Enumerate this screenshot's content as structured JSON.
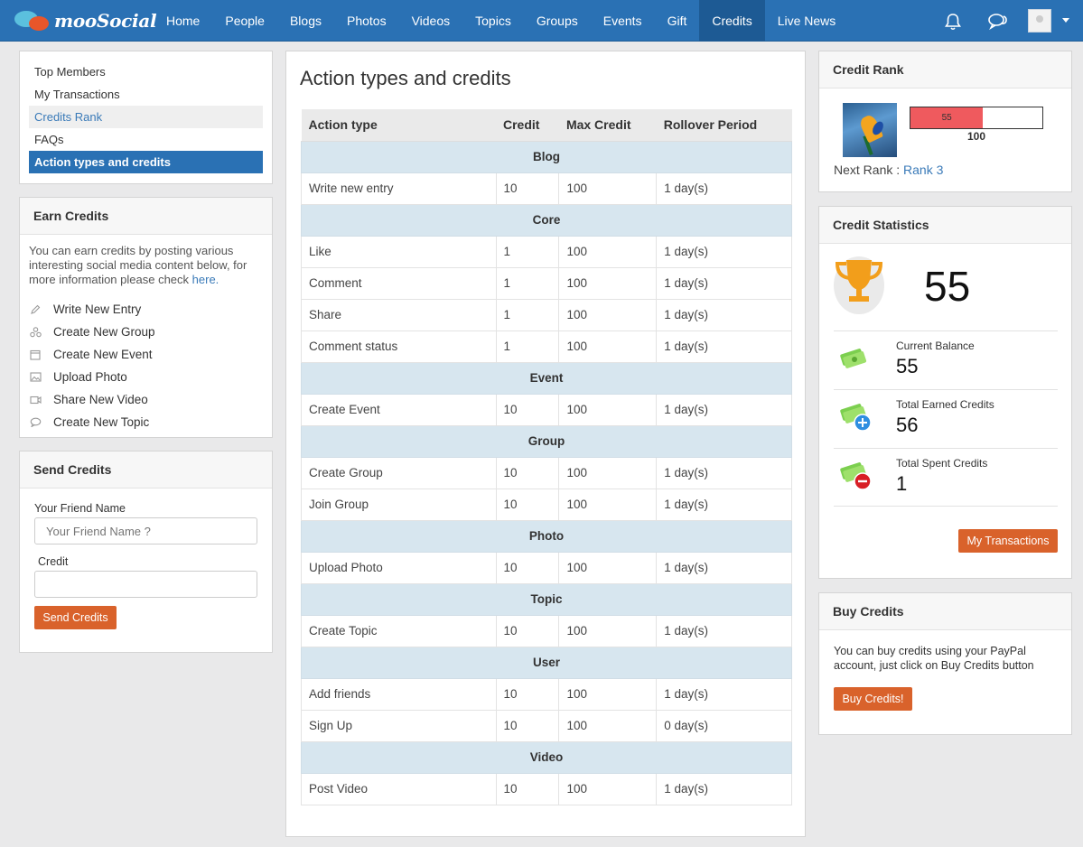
{
  "brand": {
    "name": "mooSocial"
  },
  "nav": {
    "items": [
      "Home",
      "People",
      "Blogs",
      "Photos",
      "Videos",
      "Topics",
      "Groups",
      "Events",
      "Gift",
      "Credits",
      "Live News"
    ],
    "active": "Credits"
  },
  "icons": {
    "notifications": "bell-icon",
    "messages": "chat-icon",
    "account": "avatar",
    "account_menu": "caret-down-icon"
  },
  "left_menu": {
    "items": [
      "Top Members",
      "My Transactions",
      "Credits Rank",
      "FAQs",
      "Action types and credits"
    ],
    "highlighted": "Credits Rank",
    "active": "Action types and credits"
  },
  "earn_credits": {
    "title": "Earn Credits",
    "description": "You can earn credits by posting various interesting social media content below, for more information please check",
    "link": "here.",
    "items": [
      {
        "label": "Write New Entry",
        "icon": "pencil-icon"
      },
      {
        "label": "Create New Group",
        "icon": "group-icon"
      },
      {
        "label": "Create New Event",
        "icon": "calendar-icon"
      },
      {
        "label": "Upload Photo",
        "icon": "image-icon"
      },
      {
        "label": "Share New Video",
        "icon": "video-icon"
      },
      {
        "label": "Create New Topic",
        "icon": "topic-icon"
      }
    ]
  },
  "send_credits": {
    "title": "Send Credits",
    "friend_label": "Your Friend Name",
    "friend_placeholder": "Your Friend Name ?",
    "credit_label": "Credit",
    "credit_value": "",
    "button": "Send Credits"
  },
  "main": {
    "title": "Action types and credits",
    "columns": [
      "Action type",
      "Credit",
      "Max Credit",
      "Rollover Period"
    ],
    "groups": [
      {
        "name": "Blog",
        "rows": [
          [
            "Write new entry",
            "10",
            "100",
            "1 day(s)"
          ]
        ]
      },
      {
        "name": "Core",
        "rows": [
          [
            "Like",
            "1",
            "100",
            "1 day(s)"
          ],
          [
            "Comment",
            "1",
            "100",
            "1 day(s)"
          ],
          [
            "Share",
            "1",
            "100",
            "1 day(s)"
          ],
          [
            "Comment status",
            "1",
            "100",
            "1 day(s)"
          ]
        ]
      },
      {
        "name": "Event",
        "rows": [
          [
            "Create Event",
            "10",
            "100",
            "1 day(s)"
          ]
        ]
      },
      {
        "name": "Group",
        "rows": [
          [
            "Create Group",
            "10",
            "100",
            "1 day(s)"
          ],
          [
            "Join Group",
            "10",
            "100",
            "1 day(s)"
          ]
        ]
      },
      {
        "name": "Photo",
        "rows": [
          [
            "Upload Photo",
            "10",
            "100",
            "1 day(s)"
          ]
        ]
      },
      {
        "name": "Topic",
        "rows": [
          [
            "Create Topic",
            "10",
            "100",
            "1 day(s)"
          ]
        ]
      },
      {
        "name": "User",
        "rows": [
          [
            "Add friends",
            "10",
            "100",
            "1 day(s)"
          ],
          [
            "Sign Up",
            "10",
            "100",
            "0 day(s)"
          ]
        ]
      },
      {
        "name": "Video",
        "rows": [
          [
            "Post Video",
            "10",
            "100",
            "1 day(s)"
          ]
        ]
      }
    ]
  },
  "credit_rank": {
    "title": "Credit Rank",
    "progress_value": "55",
    "progress_max": "100",
    "progress_fraction": 0.55,
    "next_rank_label": "Next Rank :",
    "next_rank": "Rank 3",
    "colors": {
      "progress_fill": "#ef5a5e"
    }
  },
  "credit_statistics": {
    "title": "Credit Statistics",
    "total": "55",
    "current_balance_label": "Current Balance",
    "current_balance": "55",
    "earned_label": "Total Earned Credits",
    "earned": "56",
    "spent_label": "Total Spent Credits",
    "spent": "1",
    "button": "My Transactions"
  },
  "buy_credits": {
    "title": "Buy Credits",
    "description": "You can buy credits using your PayPal account, just click on Buy Credits button",
    "button": "Buy Credits!"
  },
  "colors": {
    "primary": "#2a71b4",
    "accent": "#d9622b",
    "group_row": "#d7e6ef"
  }
}
